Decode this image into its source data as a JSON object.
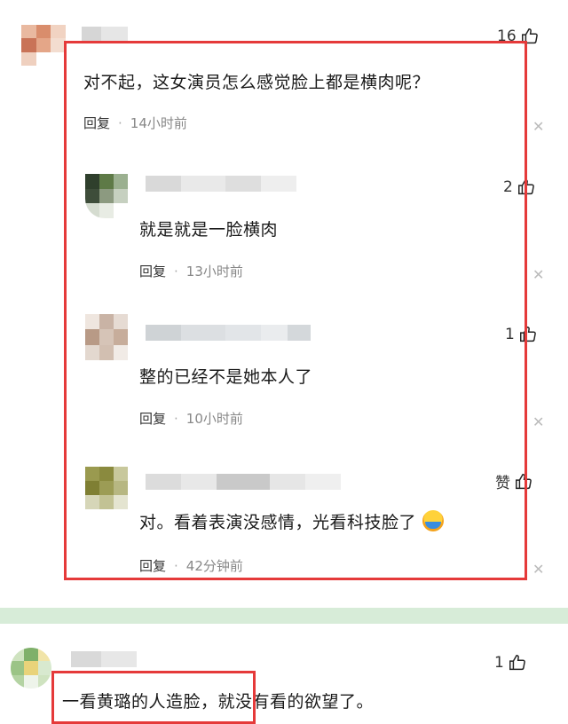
{
  "thread": {
    "top": {
      "likes": "16",
      "text": "对不起，这女演员怎么感觉脸上都是横肉呢？",
      "reply_label": "回复",
      "time": "14小时前"
    },
    "replies": [
      {
        "likes": "2",
        "text": "就是就是一脸横肉",
        "reply_label": "回复",
        "time": "13小时前"
      },
      {
        "likes": "1",
        "text": "整的已经不是她本人了",
        "reply_label": "回复",
        "time": "10小时前"
      },
      {
        "likes": "赞",
        "text": "对。看着表演没感情，光看科技脸了",
        "reply_label": "回复",
        "time": "42分钟前"
      }
    ]
  },
  "second_comment": {
    "likes": "1",
    "text": "一看黄璐的人造脸，就没有看的欲望了。"
  },
  "icons": {
    "like": "thumbs-up-icon",
    "close": "close-icon",
    "emoji": "laughing-crying-emoji"
  },
  "colors": {
    "highlight_border": "#e53a3a",
    "divider": "#d7ecd8"
  }
}
